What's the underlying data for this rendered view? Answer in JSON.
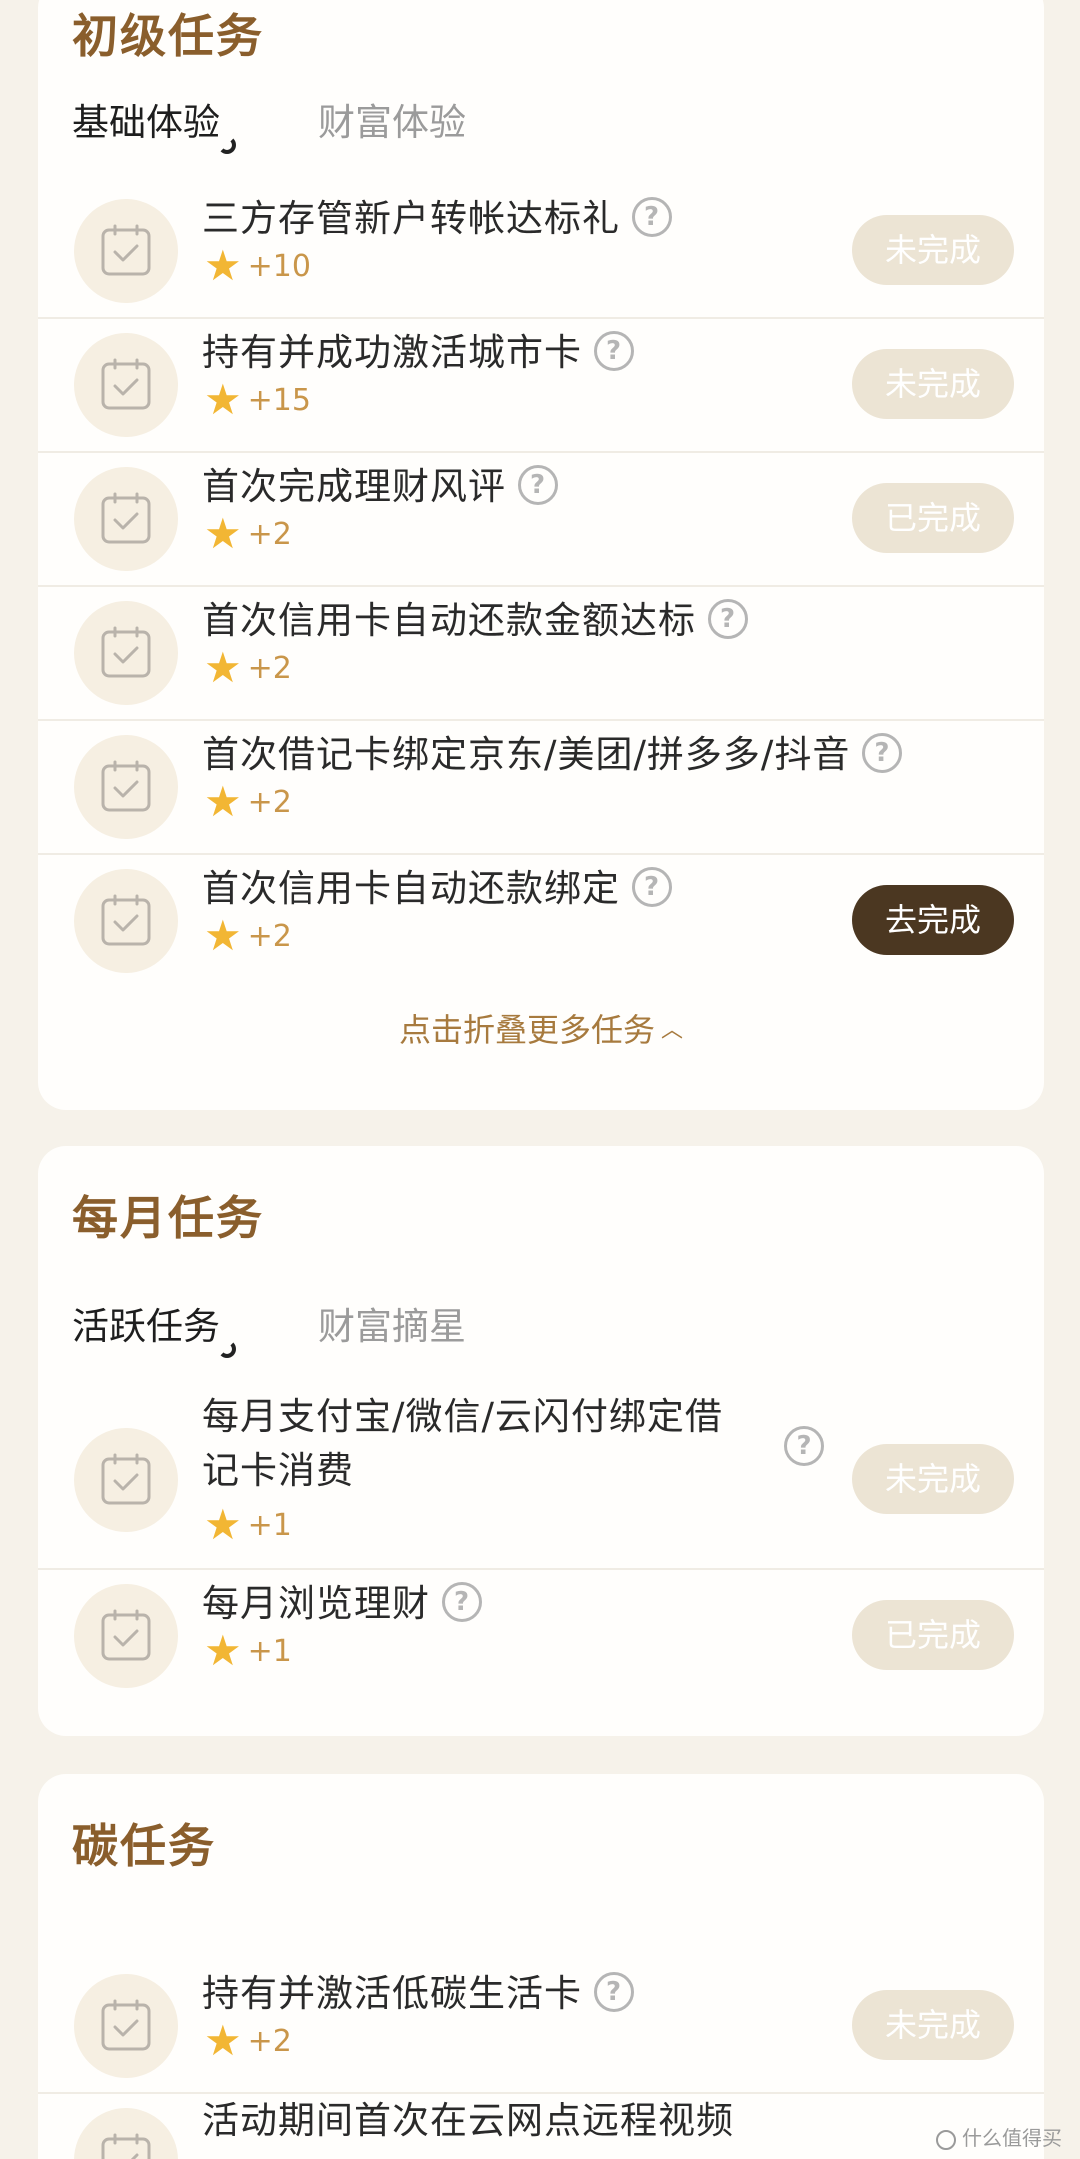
{
  "sections": [
    {
      "title": "初级任务",
      "tabs": [
        {
          "label": "基础体验",
          "active": true
        },
        {
          "label": "财富体验",
          "active": false
        }
      ],
      "tasks": [
        {
          "title": "三方存管新户转帐达标礼",
          "reward": "+10",
          "status": "未完成"
        },
        {
          "title": "持有并成功激活城市卡",
          "reward": "+15",
          "status": "未完成"
        },
        {
          "title": "首次完成理财风评",
          "reward": "+2",
          "status": "已完成"
        },
        {
          "title": "首次信用卡自动还款金额达标",
          "reward": "+2",
          "status": ""
        },
        {
          "title": "首次借记卡绑定京东/美团/拼多多/抖音",
          "reward": "+2",
          "status": ""
        },
        {
          "title": "首次信用卡自动还款绑定",
          "reward": "+2",
          "status": "去完成"
        }
      ],
      "fold_label": "点击折叠更多任务"
    },
    {
      "title": "每月任务",
      "tabs": [
        {
          "label": "活跃任务",
          "active": true
        },
        {
          "label": "财富摘星",
          "active": false
        }
      ],
      "tasks": [
        {
          "title_line1": "每月支付宝/微信/云闪付绑定借",
          "title_line2": "记卡消费",
          "reward": "+1",
          "status": "未完成"
        },
        {
          "title": "每月浏览理财",
          "reward": "+1",
          "status": "已完成"
        }
      ]
    },
    {
      "title": "碳任务",
      "tasks": [
        {
          "title": "持有并激活低碳生活卡",
          "reward": "+2",
          "status": "未完成"
        },
        {
          "title": "活动期间首次在云网点远程视频",
          "reward": "",
          "status": ""
        }
      ]
    }
  ],
  "watermark": "什么值得买",
  "colors": {
    "title": "#8a5e2c",
    "status_disabled": "#ece4d4",
    "status_active": "#4b3721",
    "star": "#f2b634",
    "reward_text": "#c9964a"
  }
}
